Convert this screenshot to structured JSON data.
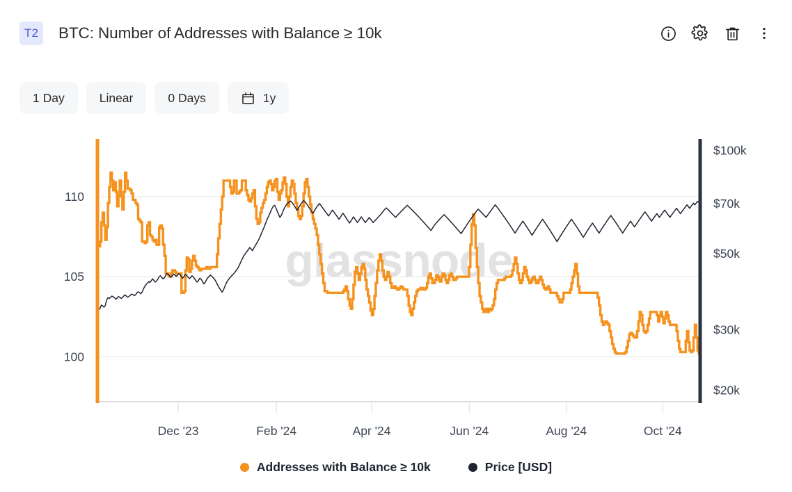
{
  "header": {
    "badge": "T2",
    "title": "BTC: Number of Addresses with Balance ≥ 10k",
    "actions": [
      {
        "name": "info-icon",
        "label": "Info"
      },
      {
        "name": "gear-icon",
        "label": "Settings"
      },
      {
        "name": "trash-icon",
        "label": "Delete"
      },
      {
        "name": "more-vertical-icon",
        "label": "More options"
      }
    ]
  },
  "toolbar": {
    "resolution": "1 Day",
    "scale": "Linear",
    "smoothing": "0 Days",
    "date_range": "1y",
    "calendar_icon": "calendar-icon"
  },
  "watermark": "glassnode",
  "colors": {
    "orange": "#f5921e",
    "price": "#1f2430",
    "grid": "#eeeeee",
    "axis_right": "#2b3340",
    "text": "#3d4654",
    "badge_bg": "#e4e8fc",
    "badge_fg": "#4c5fd7",
    "button_bg": "#f6f7f8"
  },
  "legend": [
    {
      "label": "Addresses with Balance ≥ 10k",
      "color": "#f5921e",
      "dot": "series-dot-addresses"
    },
    {
      "label": "Price [USD]",
      "color": "#1f2430",
      "dot": "series-dot-price"
    }
  ],
  "chart_data": {
    "type": "line",
    "title": "BTC: Number of Addresses with Balance ≥ 10k",
    "xlabel": "",
    "grid": true,
    "legend_position": "bottom",
    "x_axis": {
      "tick_labels": [
        "Dec '23",
        "Feb '24",
        "Apr '24",
        "Jun '24",
        "Aug '24",
        "Oct '24"
      ],
      "tick_positions": [
        0.134,
        0.297,
        0.455,
        0.617,
        0.778,
        0.938
      ],
      "range": [
        "2023-11-01",
        "2024-11-05"
      ]
    },
    "y_axis_left": {
      "label": "Addresses with Balance ≥ 10k",
      "tick_labels": [
        "110",
        "105",
        "100"
      ],
      "tick_values": [
        110,
        105,
        100
      ],
      "range": [
        97.2,
        113.6
      ],
      "scale": "linear",
      "color": "#f5921e"
    },
    "y_axis_right": {
      "label": "Price [USD]",
      "tick_labels": [
        "$100k",
        "$70k",
        "$50k",
        "$30k",
        "$20k"
      ],
      "tick_values": [
        100000,
        70000,
        50000,
        30000,
        20000
      ],
      "range": [
        18500,
        108000
      ],
      "scale": "log",
      "color": "#1f2430"
    },
    "series": [
      {
        "name": "Addresses with Balance ≥ 10k",
        "color": "#f5921e",
        "axis": "left",
        "step": true,
        "values": [
          107.0,
          106.9,
          107.2,
          108.4,
          109.0,
          108.2,
          107.3,
          108.1,
          109.6,
          110.6,
          111.5,
          111.0,
          110.4,
          110.9,
          110.3,
          109.4,
          110.1,
          111.0,
          110.0,
          109.2,
          110.3,
          111.5,
          111.0,
          110.5,
          110.5,
          110.4,
          110.2,
          109.8,
          109.8,
          109.6,
          109.5,
          108.6,
          108.5,
          108.4,
          107.2,
          107.2,
          107.1,
          107.2,
          108.2,
          108.4,
          107.6,
          107.5,
          107.3,
          107.2,
          107.3,
          107.0,
          107.0,
          108.1,
          108.2,
          108.0,
          107.0,
          106.3,
          105.2,
          105.2,
          105.1,
          105.0,
          105.2,
          105.4,
          105.4,
          105.3,
          105.2,
          105.2,
          105.2,
          105.2,
          104.0,
          104.0,
          104.1,
          105.4,
          106.2,
          106.1,
          105.3,
          105.5,
          106.0,
          106.3,
          106.0,
          105.7,
          105.6,
          105.5,
          105.4,
          105.5,
          105.5,
          105.5,
          105.5,
          105.6,
          105.5,
          105.5,
          105.6,
          105.6,
          105.6,
          105.6,
          105.6,
          106.4,
          107.4,
          108.3,
          109.2,
          110.0,
          111.0,
          111.0,
          111.0,
          111.0,
          111.0,
          110.6,
          110.2,
          110.3,
          111.0,
          111.0,
          110.2,
          110.2,
          110.3,
          110.4,
          111.0,
          111.0,
          111.0,
          110.4,
          110.1,
          109.8,
          109.7,
          109.9,
          110.2,
          110.4,
          109.4,
          108.6,
          108.3,
          108.4,
          109.0,
          109.3,
          109.6,
          109.8,
          110.2,
          110.6,
          110.9,
          111.0,
          110.8,
          110.4,
          110.6,
          111.0,
          111.1,
          110.3,
          109.8,
          110.2,
          110.4,
          110.9,
          111.2,
          110.8,
          110.0,
          109.4,
          110.0,
          110.6,
          111.0,
          110.8,
          110.2,
          109.6,
          109.2,
          108.8,
          108.6,
          108.8,
          109.4,
          110.2,
          110.9,
          111.1,
          110.6,
          110.0,
          109.5,
          109.0,
          108.6,
          108.3,
          108.0,
          107.6,
          107.0,
          106.4,
          105.8,
          105.2,
          104.6,
          104.1,
          104.1,
          104.0,
          104.0,
          104.0,
          104.0,
          104.0,
          104.0,
          104.0,
          104.0,
          104.0,
          104.0,
          104.0,
          104.0,
          104.1,
          104.2,
          104.4,
          104.1,
          103.6,
          103.2,
          103.0,
          103.6,
          104.5,
          105.3,
          105.6,
          105.2,
          104.8,
          105.2,
          105.6,
          105.8,
          105.5,
          104.8,
          104.2,
          103.8,
          103.4,
          102.9,
          102.6,
          103.0,
          103.8,
          104.6,
          105.4,
          106.0,
          106.4,
          106.0,
          105.4,
          105.0,
          104.8,
          105.0,
          105.3,
          105.0,
          104.6,
          104.3,
          104.3,
          104.4,
          104.3,
          104.2,
          104.2,
          104.3,
          104.4,
          104.3,
          104.2,
          104.2,
          104.2,
          103.8,
          103.2,
          102.8,
          102.6,
          103.0,
          103.4,
          103.8,
          104.1,
          104.2,
          104.2,
          104.3,
          104.3,
          104.2,
          104.2,
          104.3,
          104.6,
          105.0,
          105.2,
          104.9,
          104.6,
          104.6,
          104.8,
          105.1,
          105.0,
          104.8,
          104.7,
          105.0,
          105.2,
          105.1,
          104.8,
          104.6,
          104.8,
          105.1,
          105.2,
          105.0,
          104.8,
          104.8,
          104.9,
          105.0,
          105.0,
          105.0,
          105.0,
          105.0,
          105.0,
          105.0,
          105.0,
          105.0,
          105.6,
          107.0,
          108.3,
          108.9,
          108.2,
          106.8,
          105.6,
          104.6,
          103.8,
          103.4,
          103.0,
          102.8,
          102.9,
          103.0,
          102.8,
          103.0,
          102.9,
          103.0,
          103.2,
          103.6,
          104.2,
          104.6,
          104.8,
          104.8,
          104.8,
          104.8,
          104.8,
          104.9,
          105.0,
          105.0,
          105.0,
          105.0,
          105.1,
          105.4,
          105.8,
          106.2,
          105.8,
          105.2,
          104.8,
          104.6,
          104.8,
          105.2,
          105.6,
          105.4,
          105.0,
          104.8,
          104.6,
          104.7,
          104.9,
          105.0,
          104.8,
          104.6,
          104.6,
          104.8,
          105.0,
          104.8,
          104.5,
          104.3,
          104.2,
          104.3,
          104.4,
          104.2,
          104.0,
          104.0,
          104.0,
          104.0,
          104.0,
          103.8,
          103.6,
          103.4,
          103.4,
          103.6,
          104.0,
          104.0,
          104.0,
          104.0,
          104.0,
          104.2,
          104.6,
          105.0,
          105.4,
          105.8,
          105.2,
          104.4,
          104.0,
          104.0,
          104.0,
          104.0,
          104.0,
          104.0,
          104.0,
          104.0,
          104.0,
          104.0,
          104.0,
          104.0,
          104.0,
          104.0,
          103.7,
          103.2,
          102.6,
          102.2,
          102.0,
          102.1,
          102.2,
          102.1,
          102.0,
          101.6,
          101.2,
          100.8,
          100.5,
          100.3,
          100.2,
          100.2,
          100.2,
          100.2,
          100.2,
          100.2,
          100.2,
          100.3,
          100.6,
          101.0,
          101.4,
          101.5,
          101.4,
          101.3,
          101.2,
          101.2,
          101.6,
          102.2,
          102.8,
          102.6,
          102.0,
          101.6,
          101.5,
          101.6,
          102.0,
          102.4,
          102.8,
          102.8,
          102.8,
          102.8,
          102.8,
          102.6,
          102.2,
          102.6,
          102.8,
          102.5,
          102.1,
          102.4,
          102.8,
          102.6,
          102.2,
          102.0,
          102.0,
          102.0,
          102.0,
          102.0,
          101.6,
          101.0,
          100.5,
          100.3,
          100.3,
          100.3,
          100.3,
          101.0,
          101.6,
          100.9,
          100.4,
          100.3,
          100.4,
          101.2,
          102.0,
          101.2,
          100.4,
          100.2,
          100.3
        ]
      },
      {
        "name": "Price [USD]",
        "color": "#1f2430",
        "axis": "right",
        "step": false,
        "values": [
          34800,
          34300,
          34600,
          35400,
          35200,
          34900,
          35300,
          36600,
          37200,
          37000,
          37300,
          37600,
          37400,
          37200,
          36800,
          37100,
          37500,
          37300,
          37000,
          37200,
          37600,
          37900,
          37600,
          37300,
          37500,
          37800,
          38100,
          38000,
          37700,
          37900,
          38400,
          38700,
          38500,
          38200,
          38600,
          39400,
          40100,
          40600,
          41000,
          41400,
          41200,
          41700,
          42200,
          41800,
          41300,
          41600,
          42100,
          42800,
          43100,
          42600,
          42200,
          42500,
          43200,
          43800,
          43500,
          43000,
          42700,
          43100,
          43600,
          43300,
          42900,
          43300,
          43700,
          43400,
          42800,
          42400,
          42900,
          43500,
          43200,
          42700,
          42300,
          42600,
          43100,
          42800,
          42200,
          41700,
          41300,
          41800,
          42400,
          42100,
          41500,
          40800,
          41200,
          41900,
          42500,
          42900,
          43300,
          43000,
          42600,
          42200,
          41600,
          40900,
          40200,
          39600,
          39100,
          38600,
          39200,
          40100,
          40900,
          41600,
          42100,
          42600,
          43000,
          43400,
          43800,
          44300,
          44800,
          45400,
          46200,
          47100,
          48000,
          48900,
          49600,
          50200,
          50800,
          51400,
          52100,
          51600,
          51000,
          51800,
          52600,
          53400,
          54200,
          55100,
          56200,
          57400,
          58600,
          59800,
          61200,
          62600,
          63900,
          65100,
          66400,
          67800,
          68800,
          69200,
          67800,
          66400,
          65000,
          63800,
          64600,
          66000,
          67400,
          68600,
          69600,
          70200,
          70800,
          71200,
          70600,
          69800,
          68900,
          67900,
          66900,
          67800,
          68800,
          69800,
          70600,
          71400,
          70800,
          70100,
          69200,
          68300,
          67400,
          66500,
          65600,
          66400,
          67400,
          68400,
          69200,
          70000,
          69300,
          68400,
          67600,
          66800,
          66000,
          65200,
          64400,
          65200,
          66200,
          67000,
          66200,
          65400,
          64600,
          63800,
          63000,
          63800,
          64800,
          65600,
          64800,
          63900,
          63000,
          62200,
          61400,
          62200,
          63100,
          64000,
          63200,
          62400,
          61600,
          62400,
          63200,
          64000,
          63200,
          62400,
          61600,
          62300,
          63000,
          63700,
          63000,
          62300,
          61600,
          62200,
          62800,
          63400,
          64000,
          64600,
          65200,
          66000,
          66800,
          67400,
          68000,
          67400,
          66800,
          66200,
          65600,
          65000,
          64400,
          63800,
          64400,
          65000,
          65600,
          66200,
          66800,
          67400,
          68000,
          68600,
          69200,
          68600,
          68000,
          67400,
          66800,
          66200,
          65600,
          65000,
          64400,
          63800,
          63200,
          62600,
          62000,
          61400,
          60800,
          60200,
          59600,
          59000,
          58400,
          59200,
          60000,
          60800,
          61400,
          62000,
          62600,
          63200,
          63800,
          64400,
          65000,
          64400,
          63800,
          63200,
          62600,
          62000,
          61400,
          60800,
          60200,
          59600,
          59000,
          58400,
          57800,
          57200,
          58000,
          58800,
          59600,
          60400,
          61200,
          62000,
          62800,
          63600,
          64400,
          65200,
          66000,
          66800,
          67400,
          66800,
          66200,
          65600,
          65000,
          64400,
          63800,
          64600,
          65400,
          66200,
          67000,
          67800,
          68600,
          69400,
          68600,
          67800,
          67000,
          66200,
          65400,
          64600,
          63800,
          63000,
          62200,
          61400,
          60600,
          59800,
          59000,
          58200,
          57400,
          58200,
          59000,
          59800,
          60600,
          61400,
          62200,
          61400,
          60600,
          59800,
          59000,
          58200,
          57400,
          56600,
          57400,
          58200,
          59000,
          59800,
          60600,
          61400,
          62200,
          63000,
          62200,
          61400,
          60600,
          59800,
          59000,
          58200,
          57400,
          56600,
          55800,
          55000,
          54200,
          55000,
          55800,
          56600,
          57400,
          58200,
          59000,
          59800,
          60600,
          61400,
          62200,
          63000,
          62200,
          61400,
          60600,
          59800,
          59000,
          58200,
          57400,
          56600,
          55800,
          56600,
          57400,
          58200,
          59000,
          59800,
          60600,
          61400,
          60600,
          59800,
          59000,
          58200,
          57400,
          58200,
          59000,
          59800,
          60600,
          61400,
          62200,
          63000,
          63800,
          64600,
          63800,
          63000,
          62200,
          61400,
          60600,
          59800,
          59000,
          58200,
          57400,
          58200,
          59000,
          59800,
          60600,
          61400,
          62200,
          61400,
          60600,
          59800,
          60600,
          61400,
          62200,
          63000,
          63800,
          64600,
          65400,
          66200,
          65400,
          64600,
          63800,
          63000,
          62200,
          63000,
          63800,
          64600,
          65400,
          64600,
          63800,
          64600,
          65400,
          66200,
          67000,
          66200,
          65400,
          64600,
          63800,
          64600,
          65400,
          66200,
          67000,
          67800,
          67000,
          66200,
          65400,
          66200,
          67000,
          67800,
          68600,
          69400,
          68600,
          67800,
          68600,
          69400,
          70200,
          69400,
          70200,
          71000,
          70600,
          71000
        ]
      }
    ]
  }
}
